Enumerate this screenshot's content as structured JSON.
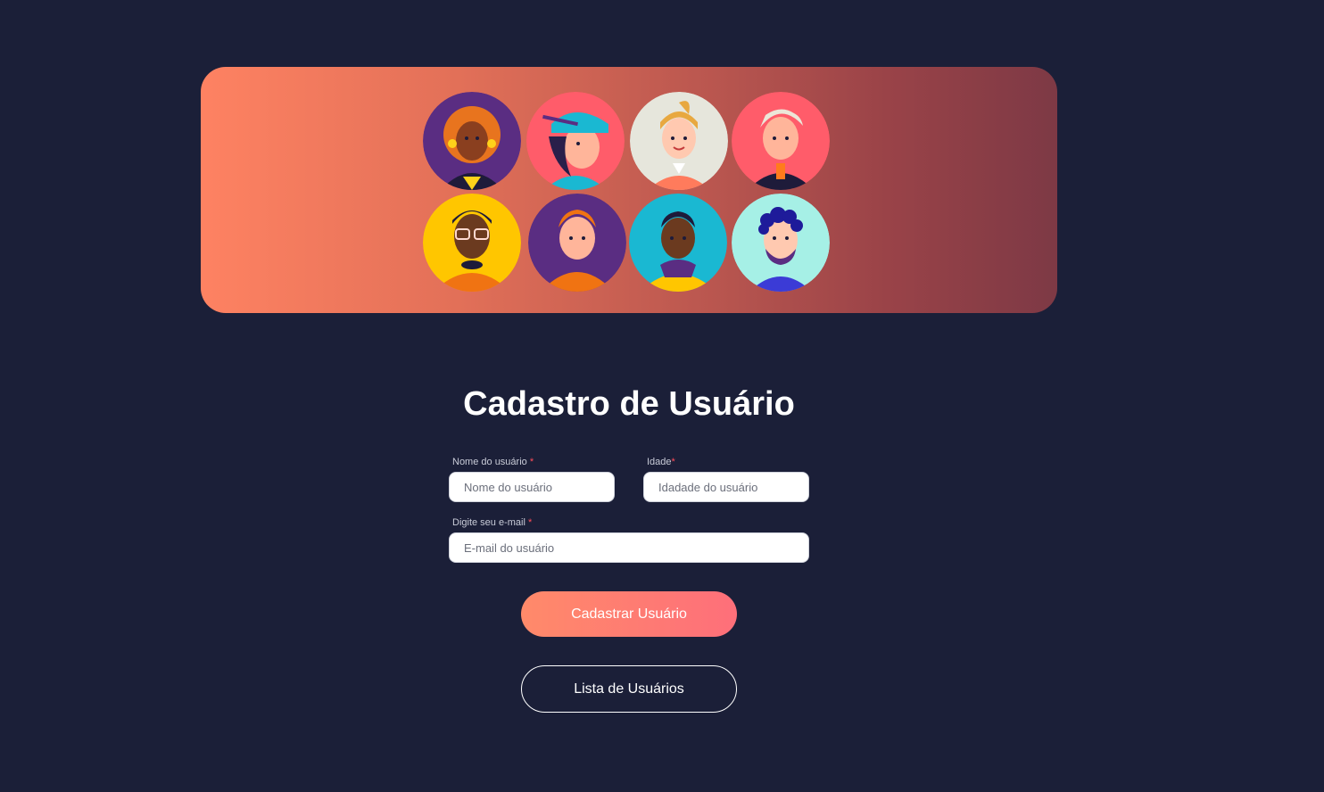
{
  "banner": {
    "avatars": [
      {
        "name": "avatar-woman-curly-orange-hair",
        "bg": "#5a2d82"
      },
      {
        "name": "avatar-woman-blue-cap",
        "bg": "#ff5c6a"
      },
      {
        "name": "avatar-woman-blonde-ponytail",
        "bg": "#e6e6dc"
      },
      {
        "name": "avatar-man-white-hair",
        "bg": "#ff5c6a"
      },
      {
        "name": "avatar-man-glasses",
        "bg": "#ffc600"
      },
      {
        "name": "avatar-man-orange-hair",
        "bg": "#5a2d82"
      },
      {
        "name": "avatar-man-yellow-jacket",
        "bg": "#1ab8d2"
      },
      {
        "name": "avatar-man-beard-curly",
        "bg": "#a6f0e6"
      }
    ]
  },
  "form": {
    "title": "Cadastro de Usuário",
    "name_label": "Nome do usuário",
    "name_placeholder": "Nome do usuário",
    "age_label": "Idade",
    "age_placeholder": "Idadade do usuário",
    "email_label": "Digite seu e-mail",
    "email_placeholder": "E-mail do usuário",
    "required_mark": "*",
    "submit_label": "Cadastrar Usuário",
    "list_label": "Lista de Usuários"
  }
}
